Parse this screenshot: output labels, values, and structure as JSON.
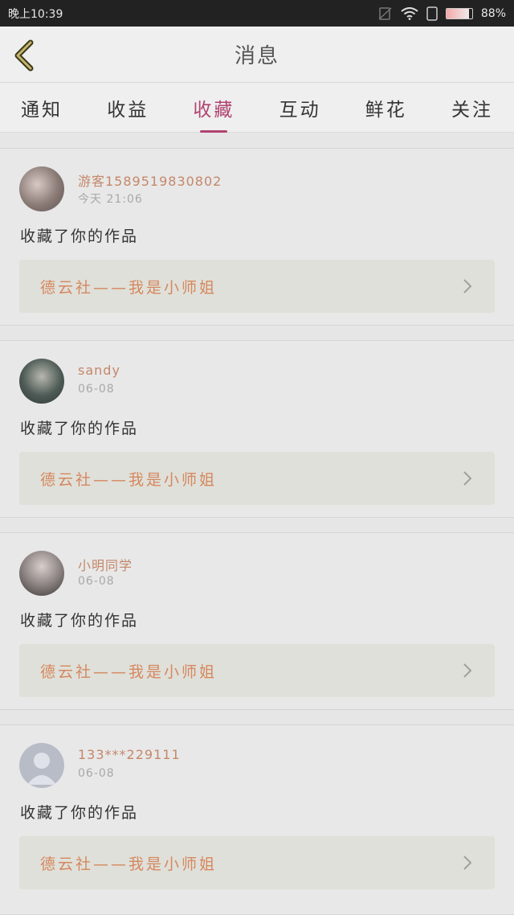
{
  "status": {
    "time": "晚上10:39",
    "battery": "88",
    "battery_level": 0.88
  },
  "header": {
    "title": "消息",
    "back_icon": "chevron-left-icon"
  },
  "tabs": [
    {
      "label": "通知"
    },
    {
      "label": "收益"
    },
    {
      "label": "收藏",
      "active": true
    },
    {
      "label": "互动"
    },
    {
      "label": "鲜花"
    },
    {
      "label": "关注"
    }
  ],
  "colors": {
    "accent": "#b04471",
    "username": "#c4876a",
    "work_title": "#d6875f"
  },
  "items": [
    {
      "user": "游客15895198308​02",
      "time": "今天 21:06",
      "action": "收藏了你的作品",
      "work": "德云社——我是小师姐"
    },
    {
      "user": "sandy",
      "time": "06-08",
      "action": "收藏了你的作品",
      "work": "德云社——我是小师姐"
    },
    {
      "user": "小明同学",
      "time": "06-08",
      "action": "收藏了你的作品",
      "work": "德云社——我是小师姐"
    },
    {
      "user": "133***229111",
      "time": "06-08",
      "action": "收藏了你的作品",
      "work": "德云社——我是小师姐"
    }
  ]
}
